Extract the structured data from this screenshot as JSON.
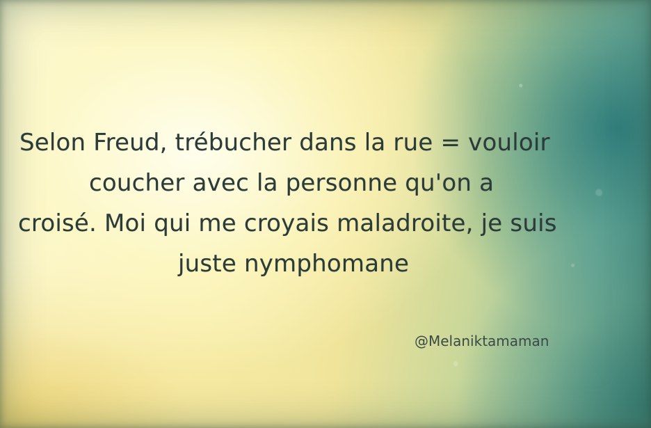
{
  "quote": {
    "lines": [
      "Selon Freud, trébucher dans la rue = vouloir",
      "coucher avec la personne qu'on a",
      "croisé. Moi qui me croyais maladroite, je suis",
      "juste nymphomane"
    ]
  },
  "author_handle": "@Melaniktamaman",
  "colors": {
    "background_light": "#fbf7d3",
    "background_yellow": "#f0e49a",
    "background_teal": "#3f8d8a",
    "text": "#2b3b38"
  }
}
